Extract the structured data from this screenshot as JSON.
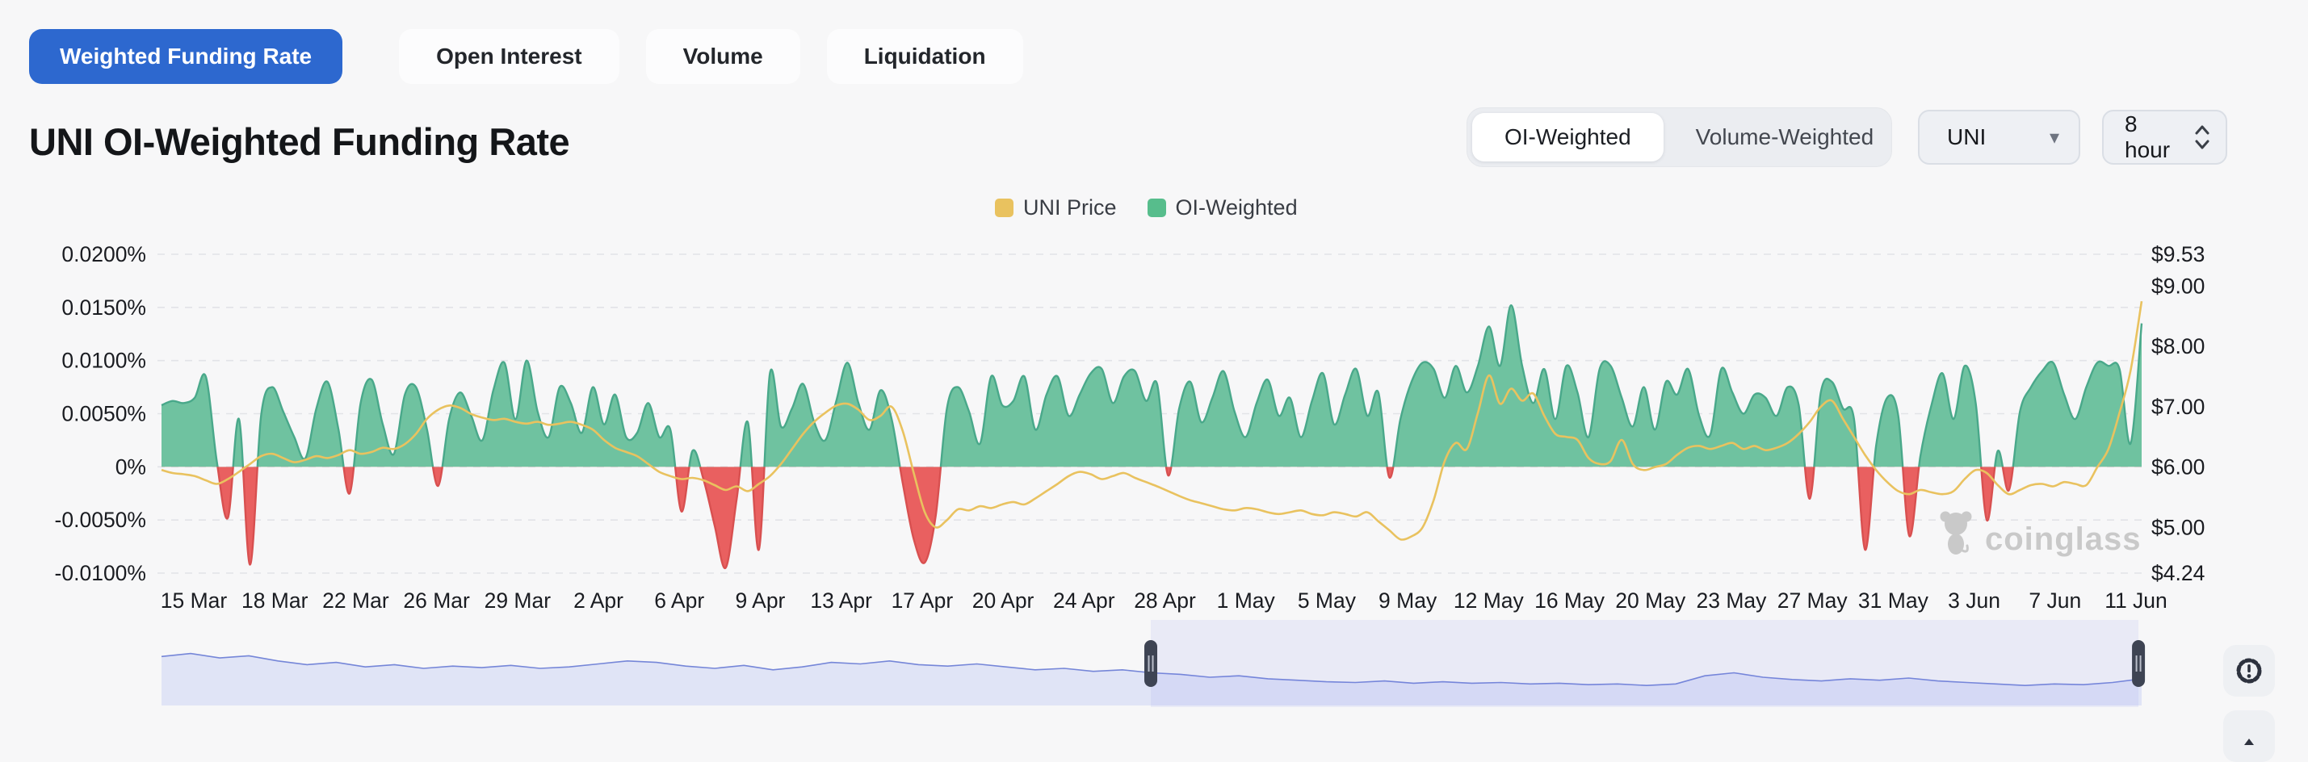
{
  "tabs": {
    "items": [
      {
        "label": "Weighted Funding Rate",
        "active": true
      },
      {
        "label": "Open Interest",
        "active": false
      },
      {
        "label": "Volume",
        "active": false
      },
      {
        "label": "Liquidation",
        "active": false
      }
    ]
  },
  "header": {
    "title": "UNI OI-Weighted Funding Rate"
  },
  "controls": {
    "mode_toggle": {
      "options": [
        "OI-Weighted",
        "Volume-Weighted"
      ],
      "selected": "OI-Weighted"
    },
    "symbol_select": {
      "value": "UNI",
      "icon": "caret-down-icon"
    },
    "interval_select": {
      "value": "8 hour",
      "icon": "up-down-chevrons-icon"
    }
  },
  "legend": {
    "items": [
      {
        "label": "UNI Price",
        "color": "#e9c25f"
      },
      {
        "label": "OI-Weighted",
        "color": "#57bd8c"
      }
    ]
  },
  "watermark": {
    "text": "coinglass",
    "icon": "coinglass-bull-logo",
    "color": "#c9c9c9"
  },
  "floating_buttons": {
    "alert_badge_icon": "badge-alert-icon",
    "bottom_partial_icon": "camera-icon"
  },
  "chart_data": {
    "type": "area+line",
    "title": "UNI OI-Weighted Funding Rate",
    "grid": {
      "horizontal": true,
      "dashed": true,
      "color": "#e2e3e7"
    },
    "x_axis": {
      "start": "13 Mar",
      "end": "11 Jun",
      "interval_hours": 12,
      "tick_labels": [
        "15 Mar",
        "18 Mar",
        "22 Mar",
        "26 Mar",
        "29 Mar",
        "2 Apr",
        "6 Apr",
        "9 Apr",
        "13 Apr",
        "17 Apr",
        "20 Apr",
        "24 Apr",
        "28 Apr",
        "1 May",
        "5 May",
        "9 May",
        "12 May",
        "16 May",
        "20 May",
        "23 May",
        "27 May",
        "31 May",
        "3 Jun",
        "7 Jun",
        "11 Jun"
      ]
    },
    "y_left": {
      "title": "funding rate (%)",
      "min": -0.01,
      "max": 0.02,
      "tick_labels": [
        "0.0200%",
        "0.0150%",
        "0.0100%",
        "0.0050%",
        "0%",
        "-0.0050%",
        "-0.0100%"
      ]
    },
    "y_right": {
      "title": "UNI price (USD)",
      "min": 4.24,
      "max": 9.53,
      "tick_labels": [
        "$9.53",
        "$9.00",
        "$8.00",
        "$7.00",
        "$6.00",
        "$5.00",
        "$4.24"
      ],
      "tick_values": [
        9.53,
        9.0,
        8.0,
        7.0,
        6.0,
        5.0,
        4.24
      ]
    },
    "series": [
      {
        "name": "OI-Weighted",
        "type": "area",
        "axis": "left",
        "positive_color": "#6fc2a0",
        "positive_stroke": "#49a88a",
        "negative_color": "#e96060",
        "negative_stroke": "#d85050",
        "values": [
          0.0058,
          0.0062,
          0.006,
          0.0065,
          0.0085,
          0.0005,
          -0.0048,
          0.0045,
          -0.0092,
          0.0048,
          0.0075,
          0.0052,
          0.0028,
          0.0008,
          0.0055,
          0.008,
          0.0035,
          -0.0025,
          0.006,
          0.0082,
          0.004,
          0.0012,
          0.0068,
          0.0075,
          0.0035,
          -0.0018,
          0.0045,
          0.007,
          0.0048,
          0.0025,
          0.0072,
          0.0098,
          0.0045,
          0.01,
          0.0052,
          0.0028,
          0.0075,
          0.006,
          0.0032,
          0.0075,
          0.004,
          0.0068,
          0.0028,
          0.0032,
          0.006,
          0.0028,
          0.0035,
          -0.0042,
          0.0015,
          -0.0012,
          -0.0055,
          -0.0095,
          -0.003,
          0.0042,
          -0.0078,
          0.0088,
          0.0038,
          0.0055,
          0.0078,
          0.0042,
          0.0025,
          0.0062,
          0.0098,
          0.006,
          0.0035,
          0.0072,
          0.0045,
          -0.0015,
          -0.0068,
          -0.009,
          -0.0045,
          0.0055,
          0.0075,
          0.0052,
          0.0022,
          0.0085,
          0.0058,
          0.0062,
          0.0085,
          0.0035,
          0.0068,
          0.0085,
          0.0048,
          0.0068,
          0.0088,
          0.0092,
          0.006,
          0.0085,
          0.009,
          0.0062,
          0.0078,
          -0.0008,
          0.0055,
          0.008,
          0.0042,
          0.0065,
          0.009,
          0.0052,
          0.0028,
          0.006,
          0.0082,
          0.0048,
          0.0065,
          0.0028,
          0.0062,
          0.0088,
          0.004,
          0.0068,
          0.0092,
          0.0048,
          0.007,
          -0.001,
          0.0045,
          0.008,
          0.0098,
          0.0092,
          0.0065,
          0.0095,
          0.007,
          0.0095,
          0.0132,
          0.0095,
          0.0152,
          0.0095,
          0.006,
          0.0092,
          0.0045,
          0.0095,
          0.007,
          0.0028,
          0.0092,
          0.0095,
          0.0065,
          0.0038,
          0.0075,
          0.0035,
          0.008,
          0.0068,
          0.0092,
          0.0048,
          0.003,
          0.0092,
          0.007,
          0.005,
          0.0068,
          0.0065,
          0.0048,
          0.0075,
          0.0058,
          -0.003,
          0.007,
          0.008,
          0.0055,
          0.0045,
          -0.0078,
          0.002,
          0.0065,
          0.0048,
          -0.0065,
          0.001,
          0.0058,
          0.0088,
          0.0045,
          0.0095,
          0.006,
          -0.005,
          0.0015,
          -0.0022,
          0.0052,
          0.0075,
          0.009,
          0.0098,
          0.0068,
          0.0045,
          0.0075,
          0.0098,
          0.0095,
          0.0092,
          0.0022,
          0.0135
        ]
      },
      {
        "name": "UNI Price",
        "type": "line",
        "axis": "right",
        "color": "#e9c25f",
        "values": [
          5.95,
          5.9,
          5.88,
          5.85,
          5.78,
          5.72,
          5.8,
          5.92,
          6.05,
          6.18,
          6.22,
          6.15,
          6.08,
          6.12,
          6.18,
          6.15,
          6.2,
          6.28,
          6.22,
          6.25,
          6.32,
          6.3,
          6.38,
          6.55,
          6.8,
          6.95,
          7.02,
          6.98,
          6.88,
          6.82,
          6.78,
          6.8,
          6.75,
          6.72,
          6.75,
          6.7,
          6.72,
          6.75,
          6.7,
          6.62,
          6.45,
          6.32,
          6.25,
          6.18,
          6.05,
          5.92,
          5.85,
          5.8,
          5.82,
          5.78,
          5.7,
          5.62,
          5.68,
          5.6,
          5.72,
          5.85,
          6.05,
          6.3,
          6.55,
          6.75,
          6.9,
          7.02,
          7.05,
          6.95,
          6.78,
          6.85,
          7.0,
          6.6,
          5.9,
          5.25,
          5.0,
          5.12,
          5.3,
          5.28,
          5.35,
          5.32,
          5.38,
          5.42,
          5.38,
          5.48,
          5.6,
          5.72,
          5.85,
          5.92,
          5.88,
          5.8,
          5.85,
          5.9,
          5.82,
          5.75,
          5.68,
          5.6,
          5.52,
          5.45,
          5.4,
          5.35,
          5.3,
          5.28,
          5.32,
          5.3,
          5.25,
          5.22,
          5.25,
          5.28,
          5.22,
          5.2,
          5.25,
          5.22,
          5.18,
          5.25,
          5.1,
          4.95,
          4.8,
          4.85,
          5.0,
          5.45,
          6.1,
          6.4,
          6.3,
          6.9,
          7.52,
          7.05,
          7.3,
          7.1,
          7.22,
          6.85,
          6.55,
          6.5,
          6.45,
          6.15,
          6.05,
          6.1,
          6.45,
          6.05,
          5.95,
          6.0,
          6.05,
          6.2,
          6.32,
          6.35,
          6.3,
          6.35,
          6.4,
          6.3,
          6.35,
          6.28,
          6.32,
          6.4,
          6.55,
          6.75,
          7.0,
          7.1,
          6.8,
          6.5,
          6.2,
          5.95,
          5.75,
          5.6,
          5.55,
          5.62,
          5.58,
          5.55,
          5.6,
          5.8,
          5.95,
          5.9,
          5.7,
          5.55,
          5.62,
          5.7,
          5.72,
          5.68,
          5.75,
          5.72,
          5.7,
          6.0,
          6.3,
          6.9,
          7.6,
          8.75
        ]
      }
    ],
    "navigator": {
      "line_color": "#7586d8",
      "fill_color": "#e0e4f6",
      "handle_color": "#3e4453",
      "selected_range_fraction": [
        0.4996,
        0.9984
      ],
      "values": [
        0.66,
        0.7,
        0.64,
        0.67,
        0.6,
        0.55,
        0.58,
        0.52,
        0.55,
        0.5,
        0.53,
        0.51,
        0.54,
        0.5,
        0.52,
        0.56,
        0.6,
        0.58,
        0.53,
        0.5,
        0.54,
        0.48,
        0.52,
        0.58,
        0.56,
        0.6,
        0.55,
        0.53,
        0.56,
        0.52,
        0.48,
        0.5,
        0.46,
        0.48,
        0.44,
        0.42,
        0.38,
        0.4,
        0.36,
        0.34,
        0.32,
        0.31,
        0.33,
        0.3,
        0.32,
        0.3,
        0.31,
        0.29,
        0.3,
        0.28,
        0.29,
        0.27,
        0.29,
        0.4,
        0.44,
        0.38,
        0.35,
        0.33,
        0.36,
        0.34,
        0.37,
        0.33,
        0.31,
        0.29,
        0.27,
        0.29,
        0.28,
        0.31,
        0.36
      ]
    }
  }
}
